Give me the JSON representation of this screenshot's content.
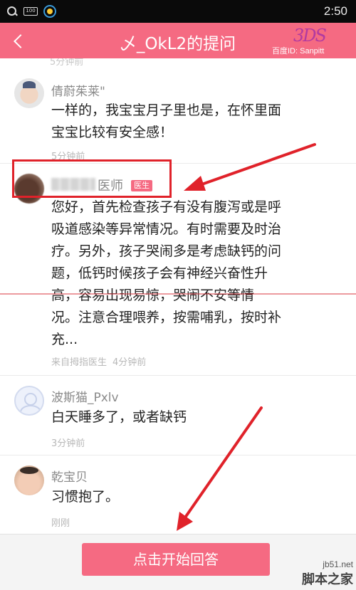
{
  "status_bar": {
    "time": "2:50",
    "battery_label": "100"
  },
  "header": {
    "title": "乄_OkL2的提问",
    "watermark_mark": "3DS",
    "watermark_text": "百度ID: Sanpitt"
  },
  "top_fragment": "5分钟前",
  "comments": [
    {
      "name": "倩蔚茱莱\"",
      "text": "一样的，我宝宝月子里也是，在怀里面\n宝宝比较有安全感！",
      "time": "5分钟前"
    },
    {
      "role": "医师",
      "badge": "医生",
      "text": "您好，首先检查孩子有没有腹泻或是呼\n吸道感染等异常情况。有时需要及时治\n疗。另外，孩子哭闹多是考虑缺钙的问\n题，低钙时候孩子会有神经兴奋性升\n高，容易出现易惊，哭闹不安等情\n况。注意合理喂养，按需哺乳，按时补\n充...",
      "source": "来自拇指医生",
      "time": "4分钟前"
    },
    {
      "name": "波斯猫_Pxlv",
      "text": "白天睡多了，或者缺钙",
      "time": "3分钟前"
    },
    {
      "name": "乾宝贝",
      "text": "习惯抱了。",
      "time": "刚刚"
    }
  ],
  "bottom": {
    "answer_label": "点击开始回答"
  },
  "site_watermark": {
    "domain": "jb51.net",
    "name": "脚本之家"
  },
  "colors": {
    "accent": "#f56a82",
    "annotation": "#e0222a"
  }
}
